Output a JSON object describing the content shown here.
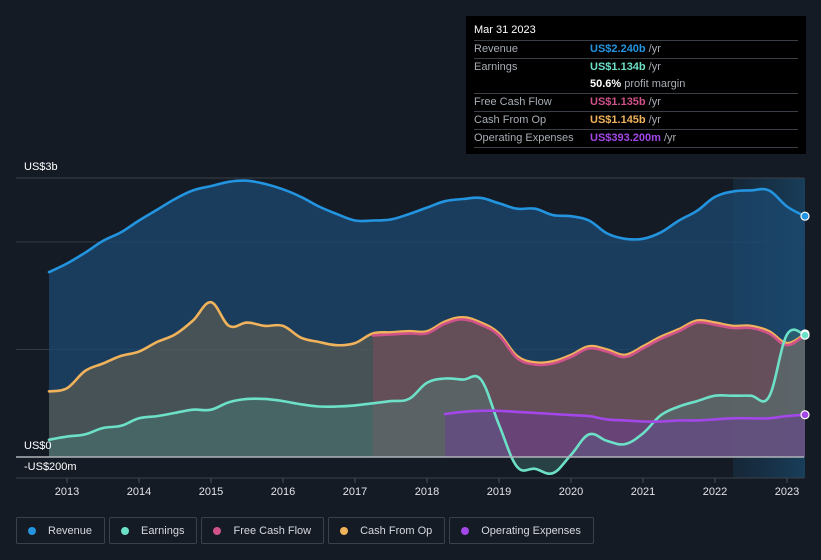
{
  "tooltip": {
    "date": "Mar 31 2023",
    "rows": [
      {
        "label": "Revenue",
        "value": "US$2.240b",
        "unit": "/yr",
        "color": "#2394df"
      },
      {
        "label": "Earnings",
        "value": "US$1.134b",
        "unit": "/yr",
        "color": "#6de0c8"
      },
      {
        "label": "",
        "value": "50.6%",
        "unit": "profit margin",
        "color": "#ffffff"
      },
      {
        "label": "Free Cash Flow",
        "value": "US$1.135b",
        "unit": "/yr",
        "color": "#d0528a"
      },
      {
        "label": "Cash From Op",
        "value": "US$1.145b",
        "unit": "/yr",
        "color": "#f0b25a"
      },
      {
        "label": "Operating Expenses",
        "value": "US$393.200m",
        "unit": "/yr",
        "color": "#a347e8"
      }
    ]
  },
  "legend": [
    {
      "label": "Revenue",
      "color": "#2394df"
    },
    {
      "label": "Earnings",
      "color": "#6de0c8"
    },
    {
      "label": "Free Cash Flow",
      "color": "#d0528a"
    },
    {
      "label": "Cash From Op",
      "color": "#f0b25a"
    },
    {
      "label": "Operating Expenses",
      "color": "#a347e8"
    }
  ],
  "chart_data": {
    "type": "area",
    "title": "",
    "xlabel": "",
    "ylabel": "",
    "unit": "US$ billions",
    "ylim": [
      -0.2,
      2.6
    ],
    "y_tick_labels": [
      {
        "label": "US$3b",
        "value": 2.6
      },
      {
        "label": "US$0",
        "value": 0
      },
      {
        "label": "-US$200m",
        "value": -0.2
      }
    ],
    "gridlines": [
      1,
      2
    ],
    "xlim": [
      2012.4,
      2023.3
    ],
    "x_tick_labels": [
      "2013",
      "2014",
      "2015",
      "2016",
      "2017",
      "2018",
      "2019",
      "2020",
      "2021",
      "2022",
      "2023"
    ],
    "x_tick_values": [
      2013,
      2014,
      2015,
      2016,
      2017,
      2018,
      2019,
      2020,
      2021,
      2022,
      2023
    ],
    "highlight_range": [
      2022.25,
      2023.25
    ],
    "x": [
      2012.75,
      2013,
      2013.25,
      2013.5,
      2013.75,
      2014,
      2014.25,
      2014.5,
      2014.75,
      2015,
      2015.25,
      2015.5,
      2015.75,
      2016,
      2016.25,
      2016.5,
      2016.75,
      2017,
      2017.25,
      2017.5,
      2017.75,
      2018,
      2018.25,
      2018.5,
      2018.75,
      2019,
      2019.25,
      2019.5,
      2019.75,
      2020,
      2020.25,
      2020.5,
      2020.75,
      2021,
      2021.25,
      2021.5,
      2021.75,
      2022,
      2022.25,
      2022.5,
      2022.75,
      2023,
      2023.25
    ],
    "series": [
      {
        "name": "Revenue",
        "color": "#2394df",
        "values": [
          1.72,
          1.8,
          1.9,
          2.01,
          2.09,
          2.2,
          2.3,
          2.4,
          2.48,
          2.52,
          2.56,
          2.57,
          2.54,
          2.49,
          2.42,
          2.33,
          2.26,
          2.2,
          2.2,
          2.21,
          2.26,
          2.32,
          2.38,
          2.4,
          2.41,
          2.36,
          2.31,
          2.31,
          2.25,
          2.24,
          2.2,
          2.08,
          2.03,
          2.03,
          2.09,
          2.2,
          2.29,
          2.42,
          2.47,
          2.48,
          2.48,
          2.33,
          2.24
        ]
      },
      {
        "name": "Cash From Op",
        "color": "#f0b25a",
        "values": [
          0.61,
          0.64,
          0.8,
          0.87,
          0.94,
          0.98,
          1.07,
          1.14,
          1.27,
          1.44,
          1.22,
          1.25,
          1.22,
          1.22,
          1.11,
          1.07,
          1.04,
          1.06,
          1.15,
          1.16,
          1.17,
          1.17,
          1.26,
          1.3,
          1.25,
          1.15,
          0.94,
          0.88,
          0.89,
          0.95,
          1.03,
          1.0,
          0.95,
          1.03,
          1.12,
          1.19,
          1.27,
          1.25,
          1.22,
          1.22,
          1.17,
          1.06,
          1.145
        ]
      },
      {
        "name": "Free Cash Flow",
        "color": "#d0528a",
        "values": [
          null,
          null,
          null,
          null,
          null,
          null,
          null,
          null,
          null,
          null,
          null,
          null,
          null,
          null,
          null,
          null,
          null,
          null,
          1.13,
          1.14,
          1.15,
          1.15,
          1.24,
          1.28,
          1.23,
          1.13,
          0.92,
          0.86,
          0.87,
          0.93,
          1.01,
          0.98,
          0.93,
          1.01,
          1.1,
          1.17,
          1.25,
          1.23,
          1.2,
          1.2,
          1.15,
          1.04,
          1.135
        ]
      },
      {
        "name": "Earnings",
        "color": "#6de0c8",
        "values": [
          0.16,
          0.19,
          0.21,
          0.27,
          0.29,
          0.36,
          0.38,
          0.41,
          0.44,
          0.44,
          0.51,
          0.54,
          0.54,
          0.52,
          0.49,
          0.47,
          0.47,
          0.48,
          0.5,
          0.52,
          0.54,
          0.69,
          0.73,
          0.72,
          0.72,
          0.3,
          -0.09,
          -0.11,
          -0.15,
          0.02,
          0.21,
          0.15,
          0.12,
          0.22,
          0.39,
          0.47,
          0.52,
          0.57,
          0.57,
          0.57,
          0.56,
          1.14,
          1.134
        ]
      },
      {
        "name": "Operating Expenses",
        "color": "#a347e8",
        "values": [
          null,
          null,
          null,
          null,
          null,
          null,
          null,
          null,
          null,
          null,
          null,
          null,
          null,
          null,
          null,
          null,
          null,
          null,
          null,
          null,
          null,
          null,
          0.4,
          0.42,
          0.43,
          0.43,
          0.42,
          0.41,
          0.4,
          0.39,
          0.38,
          0.35,
          0.34,
          0.33,
          0.33,
          0.34,
          0.34,
          0.35,
          0.36,
          0.36,
          0.36,
          0.38,
          0.393
        ]
      }
    ]
  }
}
